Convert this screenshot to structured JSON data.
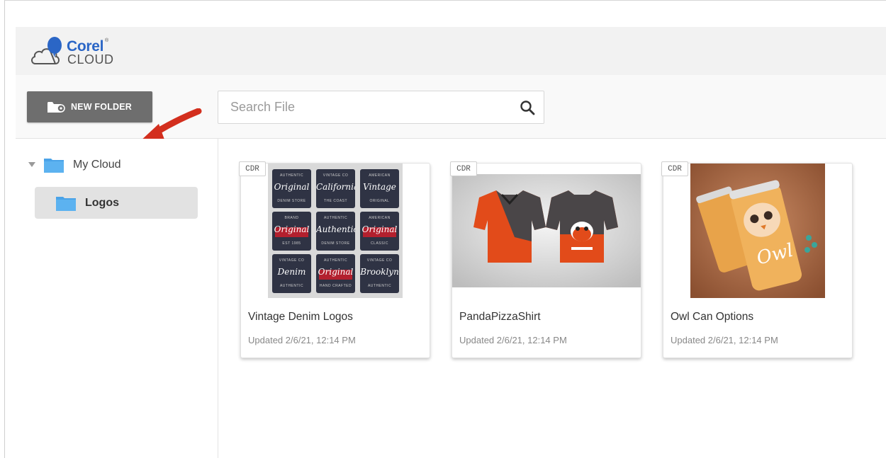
{
  "brand": {
    "name_line1": "Corel",
    "name_line2": "CLOUD",
    "registered_mark": "®",
    "accent_color": "#2b66c6"
  },
  "toolbar": {
    "new_folder_label": "NEW FOLDER",
    "search_placeholder": "Search File",
    "search_value": ""
  },
  "sidebar": {
    "root_label": "My Cloud",
    "items": [
      {
        "label": "Logos",
        "selected": true,
        "icon": "folder-icon"
      }
    ],
    "folder_color": "#4aa3e8"
  },
  "files": [
    {
      "badge": "CDR",
      "title": "Vintage Denim Logos",
      "updated": "Updated 2/6/21, 12:14 PM"
    },
    {
      "badge": "CDR",
      "title": "PandaPizzaShirt",
      "updated": "Updated 2/6/21, 12:14 PM"
    },
    {
      "badge": "CDR",
      "title": "Owl Can Options",
      "updated": "Updated 2/6/21, 12:14 PM"
    }
  ],
  "thumbnails": {
    "logo_tiles": [
      {
        "top": "AUTHENTIC",
        "script": "Original",
        "bottom": "DENIM STORE",
        "accent": false
      },
      {
        "top": "VINTAGE CO",
        "script": "California",
        "bottom": "THE COAST",
        "accent": false
      },
      {
        "top": "AMERICAN",
        "script": "Vintage",
        "bottom": "ORIGINAL",
        "accent": false
      },
      {
        "top": "BRAND",
        "script": "Original",
        "bottom": "EST 1985",
        "accent": true
      },
      {
        "top": "AUTHENTIC",
        "script": "Authentic",
        "bottom": "DENIM STORE",
        "accent": false
      },
      {
        "top": "AMERICAN",
        "script": "Original",
        "bottom": "CLASSIC",
        "accent": true
      },
      {
        "top": "VINTAGE CO",
        "script": "Denim",
        "bottom": "AUTHENTIC",
        "accent": false
      },
      {
        "top": "AUTHENTIC",
        "script": "Original",
        "bottom": "HAND CRAFTED",
        "accent": true
      },
      {
        "top": "VINTAGE CO",
        "script": "Brooklyn",
        "bottom": "AUTHENTIC",
        "accent": false
      }
    ]
  },
  "colors": {
    "button_bg": "#6e6e6e",
    "arrow_red": "#d32f1e",
    "selected_item_bg": "#e2e2e2"
  }
}
